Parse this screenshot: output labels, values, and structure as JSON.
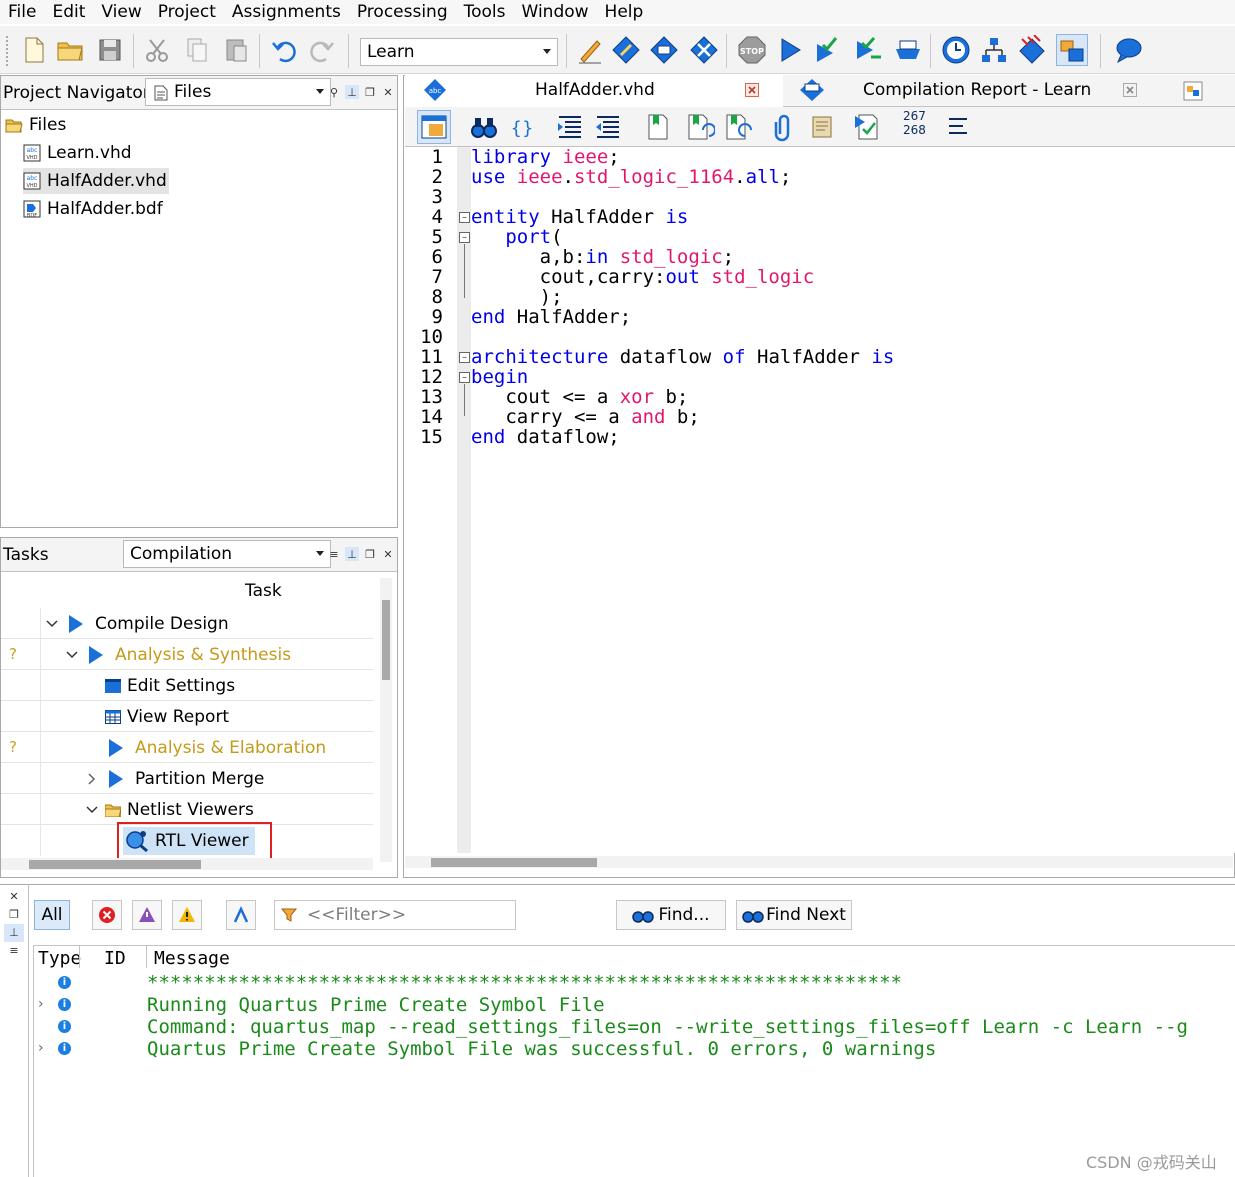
{
  "menu": [
    "File",
    "Edit",
    "View",
    "Project",
    "Assignments",
    "Processing",
    "Tools",
    "Window",
    "Help"
  ],
  "toolbar": {
    "project_combo": "Learn",
    "icons": [
      "new-file-icon",
      "open-folder-icon",
      "save-icon",
      "cut-icon",
      "copy-icon",
      "paste-icon",
      "undo-icon",
      "redo-icon",
      "pin-planner-icon",
      "assignment-editor-icon",
      "chip-planner-icon",
      "hierarchy-icon",
      "stop-icon",
      "compile-play-icon",
      "analysis-icon",
      "fitter-icon",
      "assembler-icon",
      "timing-analyzer-icon",
      "netlist-viewer-icon",
      "programmer-icon",
      "platform-designer-icon",
      "help-bubble-icon"
    ]
  },
  "navigator": {
    "title": "Project Navigator",
    "view_combo": "Files",
    "root": "Files",
    "files": [
      "Learn.vhd",
      "HalfAdder.vhd",
      "HalfAdder.bdf"
    ],
    "selected_index": 1
  },
  "tasks": {
    "title": "Tasks",
    "flow_combo": "Compilation",
    "column_header": "Task",
    "rows": [
      {
        "status": "",
        "label": "Compile Design",
        "style": "normal"
      },
      {
        "status": "?",
        "label": "Analysis & Synthesis",
        "style": "yellow"
      },
      {
        "status": "",
        "label": "Edit Settings",
        "style": "normal"
      },
      {
        "status": "",
        "label": "View Report",
        "style": "normal"
      },
      {
        "status": "?",
        "label": "Analysis & Elaboration",
        "style": "yellow"
      },
      {
        "status": "",
        "label": "Partition Merge",
        "style": "normal"
      },
      {
        "status": "",
        "label": "Netlist Viewers",
        "style": "normal"
      },
      {
        "status": "",
        "label": "RTL Viewer",
        "style": "highlight"
      }
    ]
  },
  "editor": {
    "tabs": [
      {
        "label": "HalfAdder.vhd",
        "active": true
      },
      {
        "label": "Compilation Report - Learn",
        "active": false
      }
    ],
    "line_counter": [
      "267",
      "268"
    ],
    "line_numbers": [
      "1",
      "2",
      "3",
      "4",
      "5",
      "6",
      "7",
      "8",
      "9",
      "10",
      "11",
      "12",
      "13",
      "14",
      "15"
    ],
    "code": [
      [
        {
          "t": "library ",
          "c": "kw"
        },
        {
          "t": "ieee",
          "c": "ty"
        },
        {
          "t": ";",
          "c": ""
        }
      ],
      [
        {
          "t": "use ",
          "c": "kw"
        },
        {
          "t": "ieee",
          "c": "ty"
        },
        {
          "t": ".",
          "c": ""
        },
        {
          "t": "std_logic_1164",
          "c": "ty"
        },
        {
          "t": ".",
          "c": ""
        },
        {
          "t": "all",
          "c": "kw"
        },
        {
          "t": ";",
          "c": ""
        }
      ],
      [],
      [
        {
          "t": "entity ",
          "c": "kw"
        },
        {
          "t": "HalfAdder ",
          "c": ""
        },
        {
          "t": "is",
          "c": "kw"
        }
      ],
      [
        {
          "t": "   ",
          "c": ""
        },
        {
          "t": "port",
          "c": "kw"
        },
        {
          "t": "(",
          "c": ""
        }
      ],
      [
        {
          "t": "      a,b:",
          "c": ""
        },
        {
          "t": "in ",
          "c": "kw"
        },
        {
          "t": "std_logic",
          "c": "ty"
        },
        {
          "t": ";",
          "c": ""
        }
      ],
      [
        {
          "t": "      cout,carry:",
          "c": ""
        },
        {
          "t": "out ",
          "c": "kw"
        },
        {
          "t": "std_logic",
          "c": "ty"
        }
      ],
      [
        {
          "t": "      );",
          "c": ""
        }
      ],
      [
        {
          "t": "end ",
          "c": "kw"
        },
        {
          "t": "HalfAdder;",
          "c": ""
        }
      ],
      [],
      [
        {
          "t": "architecture ",
          "c": "kw"
        },
        {
          "t": "dataflow ",
          "c": ""
        },
        {
          "t": "of ",
          "c": "kw"
        },
        {
          "t": "HalfAdder ",
          "c": ""
        },
        {
          "t": "is",
          "c": "kw"
        }
      ],
      [
        {
          "t": "begin",
          "c": "kw"
        }
      ],
      [
        {
          "t": "   cout <= a ",
          "c": ""
        },
        {
          "t": "xor ",
          "c": "ty"
        },
        {
          "t": "b;",
          "c": ""
        }
      ],
      [
        {
          "t": "   carry <= a ",
          "c": ""
        },
        {
          "t": "and ",
          "c": "ty"
        },
        {
          "t": "b;",
          "c": ""
        }
      ],
      [
        {
          "t": "end ",
          "c": "kw"
        },
        {
          "t": "dataflow;",
          "c": ""
        }
      ]
    ]
  },
  "messages": {
    "all_label": "All",
    "filter_placeholder": "<<Filter>>",
    "find_label": "Find...",
    "find_next_label": "Find Next",
    "columns": [
      "Type",
      "ID",
      "Message"
    ],
    "lines": [
      {
        "expand": false,
        "text": "******************************************************************"
      },
      {
        "expand": true,
        "text": "Running Quartus Prime Create Symbol File"
      },
      {
        "expand": false,
        "text": "Command: quartus_map --read_settings_files=on --write_settings_files=off Learn -c Learn --g"
      },
      {
        "expand": true,
        "text": "Quartus Prime Create Symbol File was successful. 0 errors, 0 warnings"
      }
    ]
  },
  "watermark": "CSDN @戎码关山",
  "colors": {
    "keyword": "#0000e6",
    "type": "#e0166f",
    "message": "#1a8a1a",
    "accent": "#1b6fd8",
    "highlight_box": "#e02020"
  }
}
